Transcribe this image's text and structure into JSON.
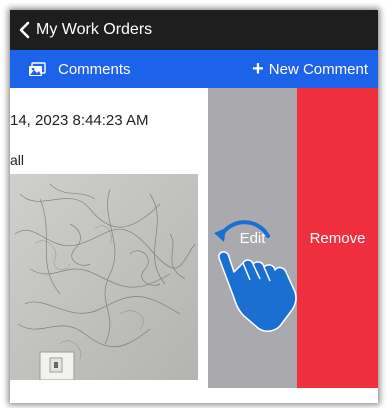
{
  "nav": {
    "back_icon": "chevron-left-icon",
    "title": "My Work Orders"
  },
  "section": {
    "comments_icon": "photo-icon",
    "comments_label": "Comments",
    "new_comment_icon": "plus-icon",
    "new_comment_plus": "+",
    "new_comment_label": "New Comment"
  },
  "comment": {
    "timestamp": "14, 2023 8:44:23 AM",
    "text": "all"
  },
  "swipe_actions": {
    "edit_label": "Edit",
    "remove_label": "Remove"
  },
  "gesture": {
    "icon": "swipe-left-hand-icon"
  },
  "colors": {
    "nav_background": "#1e1e1e",
    "section_background": "#1d63ea",
    "edit_background": "#a9a9ae",
    "remove_background": "#ef2f3d",
    "gesture_color": "#1a6fd0"
  }
}
